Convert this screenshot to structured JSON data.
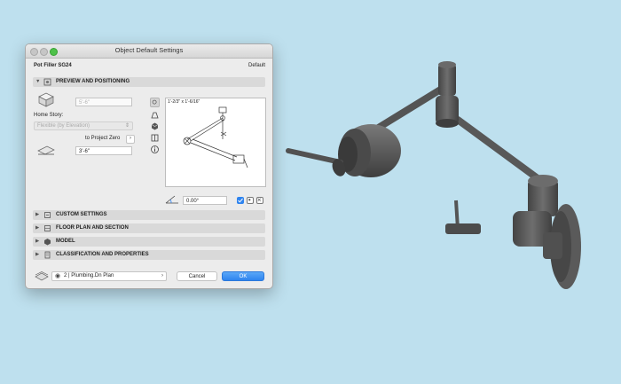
{
  "dialog": {
    "title": "Object Default Settings",
    "object_name": "Pot Filler SG24",
    "default_label": "Default"
  },
  "preview_section": {
    "label": "PREVIEW AND POSITIONING",
    "top_offset": "5'-6\"",
    "home_story_label": "Home Story:",
    "home_story_value": "Flexible (by Elevation)",
    "to_project_zero": "to Project Zero",
    "elevation_value": "3'-6\"",
    "preview_dimension": "1'-2/3\" x 1'-6/16\"",
    "angle_value": "0.00°"
  },
  "sections": [
    {
      "label": "CUSTOM SETTINGS"
    },
    {
      "label": "FLOOR PLAN AND SECTION"
    },
    {
      "label": "MODEL"
    },
    {
      "label": "CLASSIFICATION AND PROPERTIES"
    }
  ],
  "footer": {
    "layer_value": "2 | Plumbing.Dn Plan",
    "cancel_label": "Cancel",
    "ok_label": "OK"
  },
  "colors": {
    "background": "#bee0ee",
    "ok_button": "#2f84ef",
    "model_gray": "#5e5e5e"
  },
  "icons": [
    "settings-icon",
    "magnify-icon",
    "eye-icon",
    "pivot-icon",
    "floorplan-icon",
    "cube-icon",
    "section-icon",
    "info-icon",
    "layer-icon"
  ]
}
